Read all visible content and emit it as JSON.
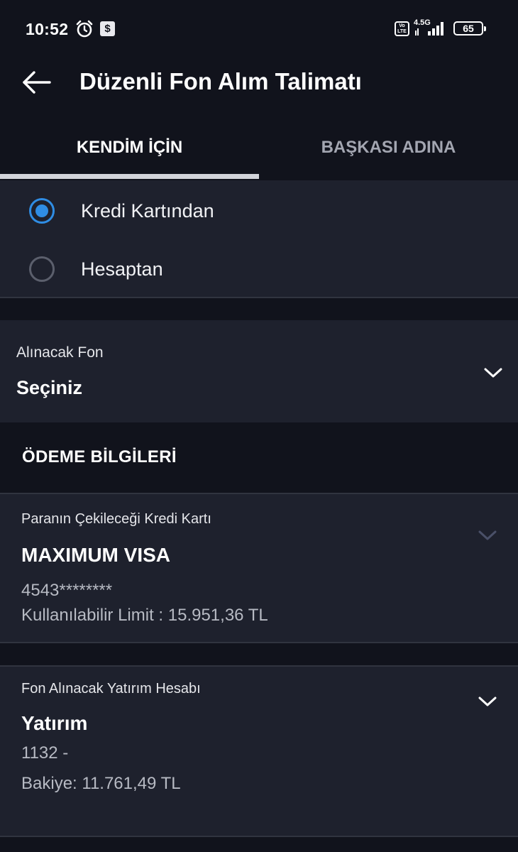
{
  "status_bar": {
    "time": "10:52",
    "network": "4.5G",
    "volte": "Vo LTE",
    "battery": "65"
  },
  "header": {
    "title": "Düzenli Fon Alım Talimatı"
  },
  "tabs": [
    {
      "label": "KENDİM İÇİN",
      "selected": true
    },
    {
      "label": "BAŞKASI ADINA",
      "selected": false
    }
  ],
  "payment_source": {
    "options": [
      {
        "label": "Kredi Kartından",
        "checked": true
      },
      {
        "label": "Hesaptan",
        "checked": false
      }
    ]
  },
  "fund_select": {
    "label": "Alınacak Fon",
    "value": "Seçiniz"
  },
  "payment_info": {
    "heading": "ÖDEME BİLGİLERİ",
    "credit_card": {
      "label": "Paranın Çekileceği Kredi Kartı",
      "name": "MAXIMUM VISA",
      "number": "4543********",
      "limit": "Kullanılabilir Limit : 15.951,36 TL"
    },
    "investment_account": {
      "label": "Fon Alınacak Yatırım Hesabı",
      "name": "Yatırım",
      "number": "1132 -",
      "balance": "Bakiye: 11.761,49 TL"
    }
  },
  "colors": {
    "background": "#11131c",
    "card": "#1e212d",
    "accent": "#2f8de4",
    "muted_text": "#b7bac3"
  },
  "icons": [
    "alarm-icon",
    "dollar-notification-icon",
    "signal-icon",
    "battery-icon",
    "back-arrow-icon",
    "chevron-down-icon"
  ]
}
